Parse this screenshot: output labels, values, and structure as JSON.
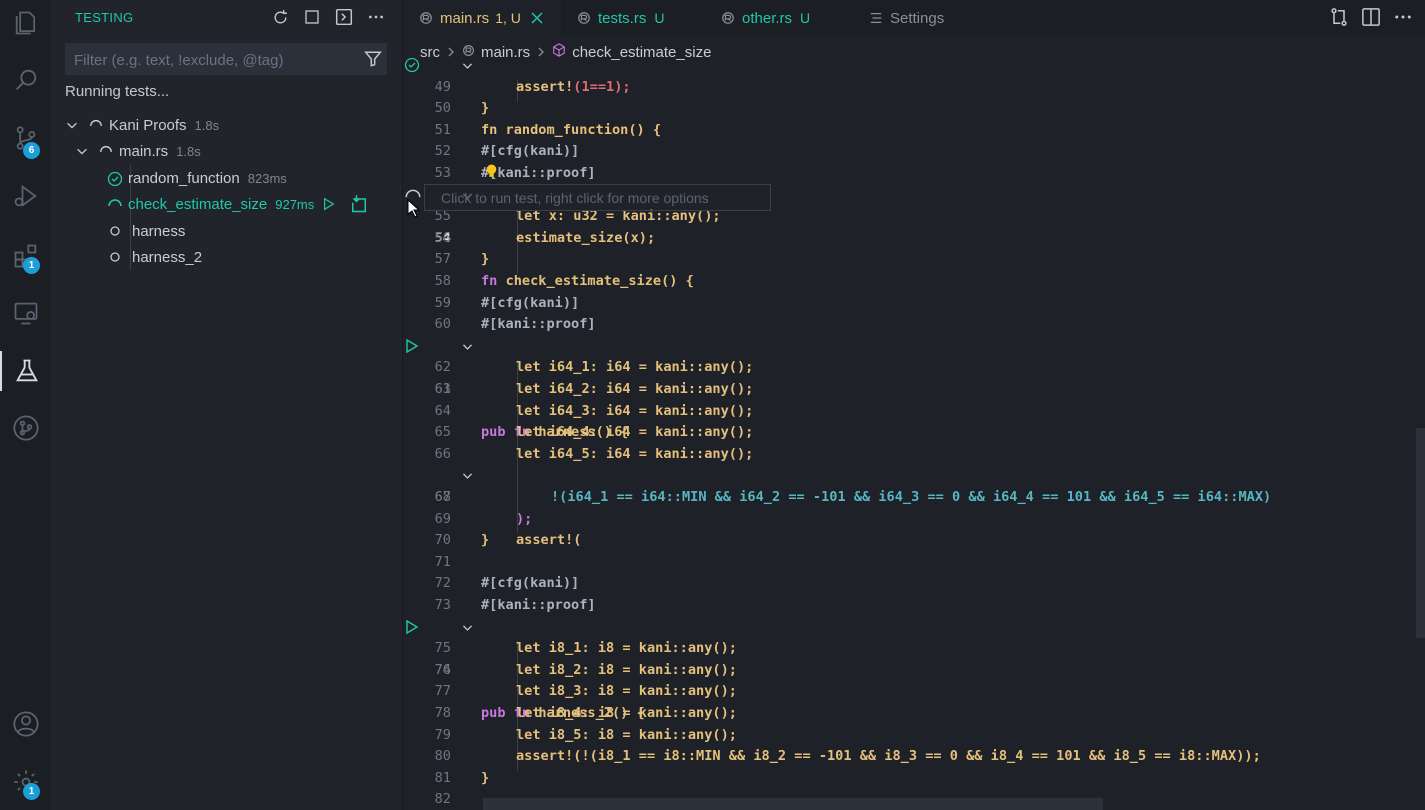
{
  "sidebar": {
    "title": "TESTING",
    "filter_placeholder": "Filter (e.g. text, !exclude, @tag)",
    "status": "Running tests...",
    "tree": [
      {
        "label": "Kani Proofs",
        "duration": "1.8s",
        "state": "running"
      },
      {
        "label": "main.rs",
        "duration": "1.8s",
        "state": "running"
      },
      {
        "label": "random_function",
        "duration": "823ms",
        "state": "passed"
      },
      {
        "label": "check_estimate_size",
        "duration": "927ms",
        "state": "running"
      },
      {
        "label": "harness",
        "duration": "",
        "state": "queued"
      },
      {
        "label": "harness_2",
        "duration": "",
        "state": "queued"
      }
    ]
  },
  "activity": {
    "badges": {
      "scm": "6",
      "extensions": "1",
      "settings": "1"
    }
  },
  "tabs": [
    {
      "name": "main.rs",
      "status": "1, U",
      "active": true
    },
    {
      "name": "tests.rs",
      "status": "U",
      "active": false
    },
    {
      "name": "other.rs",
      "status": "U",
      "active": false
    },
    {
      "name": "Settings",
      "status": "",
      "active": false
    }
  ],
  "breadcrumb": {
    "folder": "src",
    "file": "main.rs",
    "symbol": "check_estimate_size"
  },
  "editor": {
    "hover_text": "Click to run test, right click for more options",
    "lines": [
      {
        "n": "49"
      },
      {
        "n": "50"
      },
      {
        "n": "51"
      },
      {
        "n": "52"
      },
      {
        "n": "53"
      },
      {
        "n": "54"
      },
      {
        "n": "55"
      },
      {
        "n": "56"
      },
      {
        "n": "57"
      },
      {
        "n": "58"
      },
      {
        "n": "59"
      },
      {
        "n": "60"
      },
      {
        "n": "61"
      },
      {
        "n": "62"
      },
      {
        "n": "63"
      },
      {
        "n": "64"
      },
      {
        "n": "65"
      },
      {
        "n": "66"
      },
      {
        "n": "67"
      },
      {
        "n": "68"
      },
      {
        "n": "69"
      },
      {
        "n": "70"
      },
      {
        "n": "71"
      },
      {
        "n": "72"
      },
      {
        "n": "73"
      },
      {
        "n": "74"
      },
      {
        "n": "75"
      },
      {
        "n": "76"
      },
      {
        "n": "77"
      },
      {
        "n": "78"
      },
      {
        "n": "79"
      },
      {
        "n": "80"
      },
      {
        "n": "81"
      },
      {
        "n": "82"
      }
    ],
    "code": {
      "l48": "fn random_function() {",
      "l49_kw": "assert!",
      "l49_rest": "(1==1);",
      "l50": "}",
      "attr_cfg": "#[cfg(kani)]",
      "attr_proof": "#[kani::proof]",
      "l54_fn": "fn",
      "l54_name": "check_estimate_size",
      "l54_rest": "() {",
      "l55": "let x: u32 = kani::any();",
      "l56": "estimate_size(x);",
      "l61_pub": "pub",
      "l61_fn": "fn",
      "l61_name": "harness",
      "l61_rest": "() {",
      "l62": "let i64_1: i64 = kani::any();",
      "l63": "let i64_2: i64 = kani::any();",
      "l64": "let i64_3: i64 = kani::any();",
      "l65": "let i64_4: i64 = kani::any();",
      "l66": "let i64_5: i64 = kani::any();",
      "l67": "assert!(",
      "l68": "!(i64_1 == i64::MIN && i64_2 == -101 && i64_3 == 0 && i64_4 == 101 && i64_5 == i64::MAX)",
      "l69": ");",
      "l74_name": "harness_2",
      "l75": "let i8_1: i8 = kani::any();",
      "l76": "let i8_2: i8 = kani::any();",
      "l77": "let i8_3: i8 = kani::any();",
      "l78": "let i8_4: i8 = kani::any();",
      "l79": "let i8_5: i8 = kani::any();",
      "l80": "assert!(!(i8_1 == i8::MIN && i8_2 == -101 && i8_3 == 0 && i8_4 == 101 && i8_5 == i8::MAX));"
    }
  },
  "colors": {
    "accent": "#20c7a9",
    "badge": "#1c9ed9",
    "background": "#1e2127",
    "sidebar": "#21252b"
  }
}
